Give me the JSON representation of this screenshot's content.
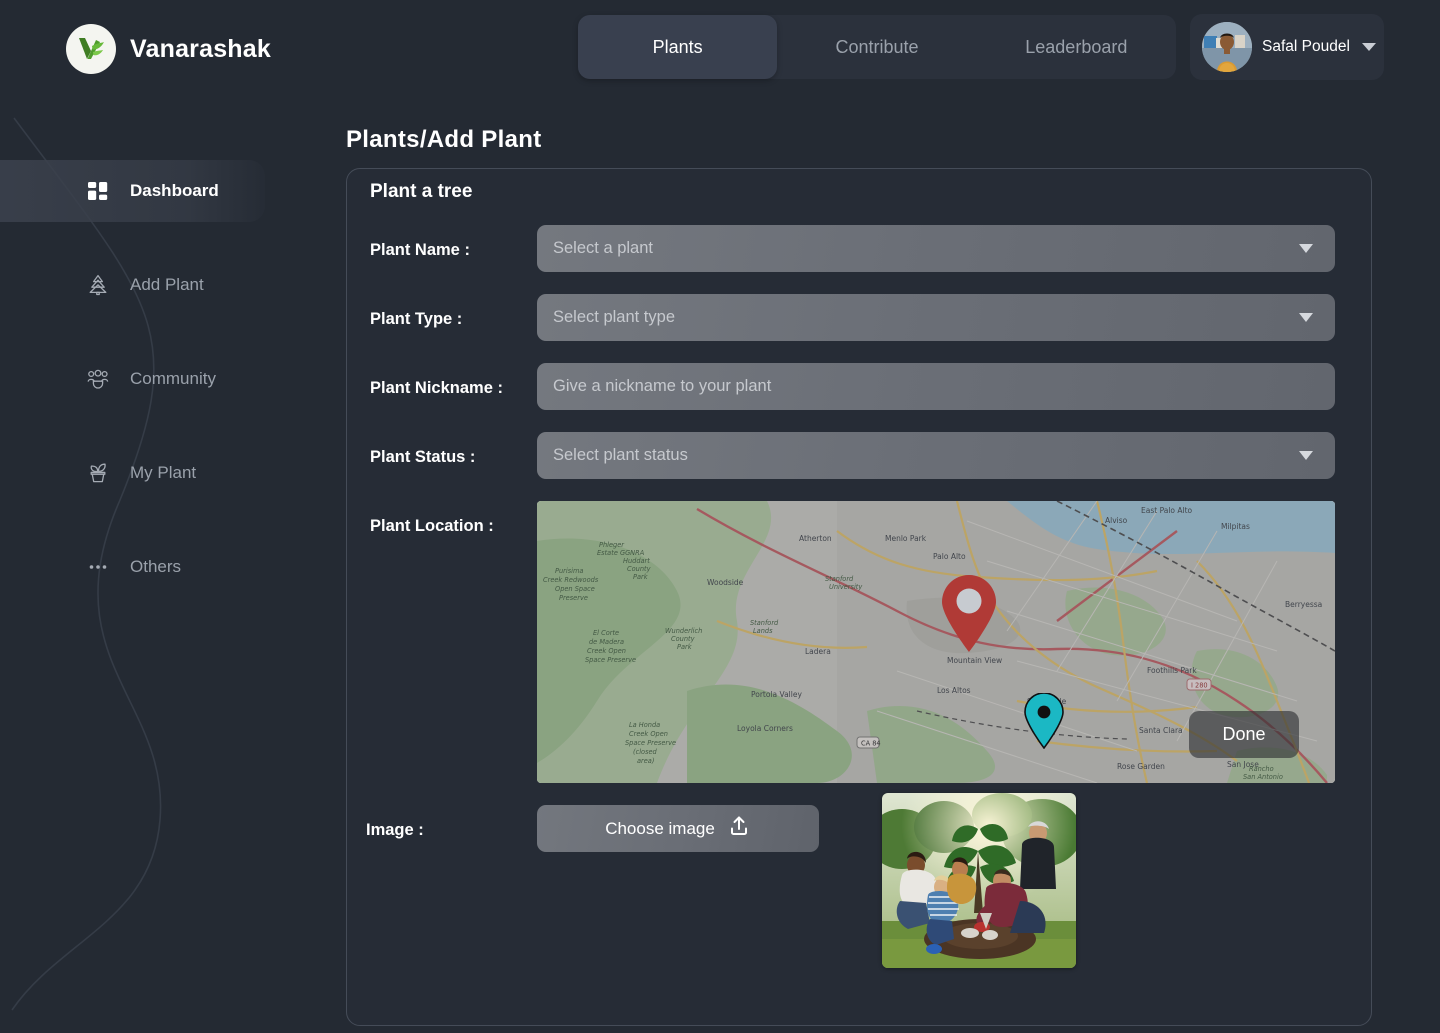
{
  "brand": {
    "name": "Vanarashak",
    "logo_icon": "leaf-v-logo"
  },
  "nav": {
    "tabs": [
      {
        "label": "Plants",
        "active": true
      },
      {
        "label": "Contribute",
        "active": false
      },
      {
        "label": "Leaderboard",
        "active": false
      }
    ]
  },
  "user": {
    "name": "Safal Poudel",
    "avatar_icon": "user-avatar",
    "caret_icon": "chevron-down-icon"
  },
  "sidebar": {
    "items": [
      {
        "label": "Dashboard",
        "icon": "grid-dashboard-icon",
        "active": true
      },
      {
        "label": "Add Plant",
        "icon": "pine-tree-icon",
        "active": false
      },
      {
        "label": "Community",
        "icon": "people-group-icon",
        "active": false
      },
      {
        "label": "My Plant",
        "icon": "potted-plant-icon",
        "active": false
      },
      {
        "label": "Others",
        "icon": "ellipsis-icon",
        "active": false
      }
    ]
  },
  "page": {
    "title": "Plants/Add Plant"
  },
  "card": {
    "title": "Plant a tree",
    "fields": [
      {
        "label": "Plant Name :",
        "placeholder": "Select a  plant",
        "type": "select",
        "value": ""
      },
      {
        "label": "Plant Type :",
        "placeholder": "Select plant type",
        "type": "select",
        "value": ""
      },
      {
        "label": "Plant Nickname :",
        "placeholder": "Give a nickname to your plant",
        "type": "text",
        "value": ""
      },
      {
        "label": "Plant Status :",
        "placeholder": "Select plant status",
        "type": "select",
        "value": ""
      }
    ],
    "location": {
      "label": "Plant Location :",
      "done_label": "Done",
      "map_labels": [
        "East Palo Alto",
        "Atherton",
        "Menlo Park",
        "Palo Alto",
        "Stanford University",
        "Woodside",
        "Stanford Lands",
        "Ladera",
        "Portola Valley",
        "Los Altos",
        "Mountain View",
        "Sunnyvale",
        "Santa Clara",
        "San Jose",
        "Milpitas",
        "Berryessa",
        "Alviso",
        "Rose Garden",
        "Loyola Corners",
        "Foothills Park",
        "Purisima Creek Redwoods Open Space Preserve",
        "El Corte de Madera Creek Open Space Preserve",
        "La Honda Creek Open Space Preserve (closed area)",
        "Huddart County Park",
        "Wunderlich County Park",
        "Phleger Estate GGNRA",
        "CA 84",
        "I 280"
      ],
      "markers": [
        {
          "name": "selected-location-pin",
          "color": "#b03a36",
          "inner": "#c7cbd0"
        },
        {
          "name": "current-location-pin",
          "color": "#1bb8c4",
          "inner": "#111111"
        }
      ]
    },
    "image": {
      "label": "Image  :",
      "button_label": "Choose image",
      "upload_icon": "upload-icon",
      "preview_alt": "people planting a tree"
    }
  },
  "colors": {
    "page_bg": "#242a33",
    "card_bg": "#262c36",
    "nav_bg": "#2b313c",
    "nav_active": "#39404f",
    "field_bg": "#6a6e76",
    "text_primary": "#ffffff",
    "text_muted": "#9aa1ab",
    "brand_green": "#4a8b2c"
  }
}
